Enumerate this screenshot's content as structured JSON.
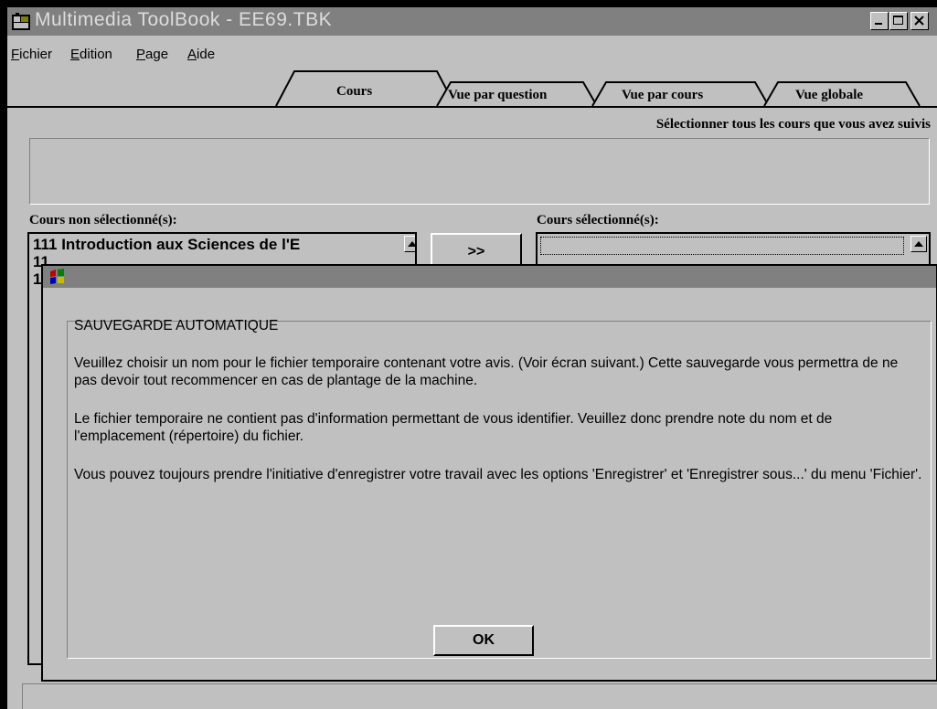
{
  "window": {
    "title": "Multimedia ToolBook - EE69.TBK",
    "minimize_label": "_",
    "maximize_label": "□",
    "close_label": "×"
  },
  "menu": {
    "items": [
      {
        "key": "F",
        "rest": "ichier"
      },
      {
        "key": "E",
        "rest": "dition"
      },
      {
        "key": "P",
        "rest": "age"
      },
      {
        "key": "A",
        "rest": "ide"
      }
    ]
  },
  "tabs": [
    {
      "label": "Cours",
      "active": true
    },
    {
      "label": "Vue par question",
      "active": false
    },
    {
      "label": "Vue par cours",
      "active": false
    },
    {
      "label": "Vue globale",
      "active": false
    }
  ],
  "instruction": "Sélectionner tous les cours que vous avez suivis",
  "unselected": {
    "label": "Cours non sélectionné(s):",
    "rows": [
      "111  Introduction aux Sciences de l'E",
      "11",
      "11"
    ]
  },
  "selected": {
    "label": "Cours sélectionné(s):",
    "rows": []
  },
  "add_button": {
    "label": ">>"
  },
  "dialog": {
    "heading": "SAUVEGARDE AUTOMATIQUE",
    "paragraphs": [
      "Veuillez choisir un nom pour le fichier temporaire contenant votre avis. (Voir écran suivant.) Cette sauvegarde vous permettra de ne pas devoir tout recommencer en cas de plantage de la machine.",
      "Le fichier temporaire ne contient pas d'information permettant de vous identifier. Veuillez donc prendre note du nom et de l'emplacement (répertoire) du fichier.",
      "Vous pouvez toujours prendre l'initiative d'enregistrer votre travail avec les options 'Enregistrer' et 'Enregistrer sous...' du menu 'Fichier'."
    ],
    "ok_label": "OK"
  },
  "colors": {
    "face": "#c0c0c0",
    "titlebar": "#808080",
    "title_text": "#dcdcdc"
  }
}
